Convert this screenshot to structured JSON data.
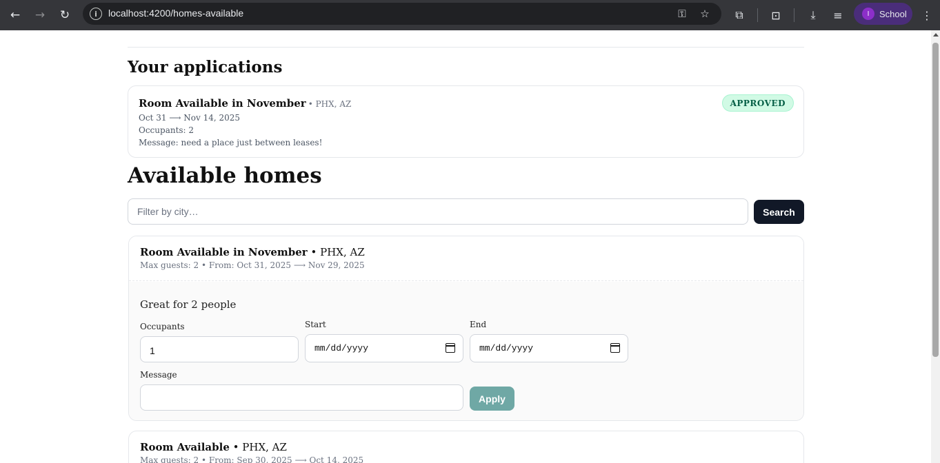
{
  "browser": {
    "url": "localhost:4200/homes-available",
    "profile_initial": "I",
    "profile_name": "School",
    "icons": [
      "back-icon",
      "forward-icon",
      "reload-icon",
      "site-info-icon",
      "password-key-icon",
      "bookmark-star-icon",
      "extensions-icon",
      "tab-search-icon",
      "download-icon",
      "media-controls-icon",
      "menu-kebab-icon"
    ]
  },
  "applications": {
    "heading": "Your applications",
    "items": [
      {
        "title": "Room Available in November",
        "location": "• PHX, AZ",
        "dates": "Oct 31 ⟶ Nov 14, 2025",
        "occupants": "Occupants: 2",
        "message": "Message: need a place just between leases!",
        "status": "APPROVED"
      }
    ]
  },
  "homes": {
    "heading": "Available homes",
    "filter_placeholder": "Filter by city…",
    "search_label": "Search",
    "listings": [
      {
        "title": "Room Available in November",
        "location": " • PHX, AZ",
        "subtitle": "Max guests: 2 • From: Oct 31, 2025 ⟶ Nov 29, 2025",
        "description": "Great for 2 people",
        "form": {
          "occupants_label": "Occupants",
          "occupants_value": "1",
          "start_label": "Start",
          "start_placeholder": "mm/dd/yyyy",
          "end_label": "End",
          "end_placeholder": "mm/dd/yyyy",
          "message_label": "Message",
          "message_value": "",
          "apply_label": "Apply"
        }
      },
      {
        "title": "Room Available",
        "location": " • PHX, AZ",
        "subtitle": "Max guests: 2 • From: Sep 30, 2025 ⟶ Oct 14, 2025"
      }
    ]
  }
}
